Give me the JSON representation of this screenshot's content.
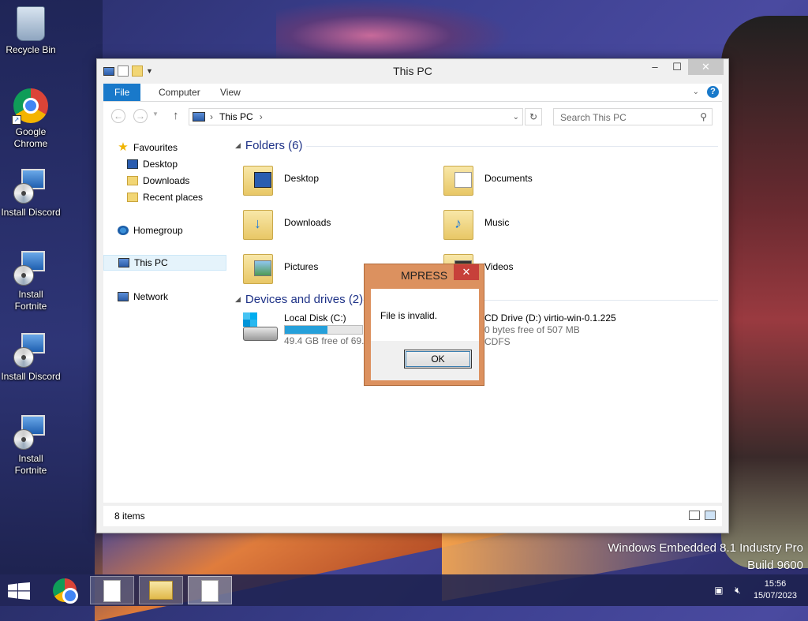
{
  "desktop": {
    "icons": [
      {
        "label": "Recycle Bin"
      },
      {
        "label": "Google Chrome"
      },
      {
        "label": "Install Discord"
      },
      {
        "label": "Install Fortnite"
      },
      {
        "label": "Install Discord"
      },
      {
        "label": "Install Fortnite"
      }
    ],
    "watermark": {
      "line1": "Windows Embedded 8.1 Industry Pro",
      "line2": "Build 9600"
    }
  },
  "window": {
    "title": "This PC",
    "ribbon_tabs": [
      {
        "label": "File"
      },
      {
        "label": "Computer"
      },
      {
        "label": "View"
      }
    ],
    "address": {
      "path": "This PC",
      "separator": "›"
    },
    "search": {
      "placeholder": "Search This PC"
    },
    "nav": {
      "favourites": "Favourites",
      "desktop": "Desktop",
      "downloads": "Downloads",
      "recent": "Recent places",
      "homegroup": "Homegroup",
      "thispc": "This PC",
      "network": "Network"
    },
    "folders_header": "Folders (6)",
    "folders": [
      {
        "label": "Desktop"
      },
      {
        "label": "Documents"
      },
      {
        "label": "Downloads"
      },
      {
        "label": "Music"
      },
      {
        "label": "Pictures"
      },
      {
        "label": "Videos"
      }
    ],
    "devices_header": "Devices and drives (2)",
    "drives": [
      {
        "name": "Local Disk (C:)",
        "free": "49.4 GB free of 69.6",
        "usage": 0.55
      },
      {
        "name": "CD Drive (D:) virtio-win-0.1.225",
        "free": "0 bytes free of 507 MB",
        "fs": "CDFS"
      }
    ],
    "status": {
      "count": "8 items"
    }
  },
  "dialog": {
    "title": "MPRESS",
    "message": "File is invalid.",
    "ok": "OK",
    "close": "✕"
  },
  "taskbar": {
    "time": "15:56",
    "date": "15/07/2023"
  },
  "colors": {
    "accent": "#1979ca",
    "dialog_frame": "#dc915f",
    "progress": "#26a0da"
  }
}
